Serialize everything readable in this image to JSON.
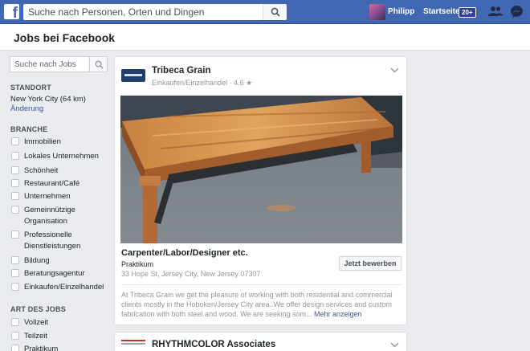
{
  "topbar": {
    "logo_letter": "f",
    "search_placeholder": "Suche nach Personen, Orten und Dingen",
    "user_name": "Philipp",
    "home_label": "Startseite",
    "home_badge": "20+"
  },
  "page": {
    "title": "Jobs bei Facebook"
  },
  "sidebar": {
    "search_placeholder": "Suche nach Jobs",
    "location_heading": "STANDORT",
    "location_value": "New York City (64 km)",
    "location_change": "Änderung",
    "industry_heading": "BRANCHE",
    "industries": [
      "Immobilien",
      "Lokales Unternehmen",
      "Schönheit",
      "Restaurant/Café",
      "Unternehmen",
      "Gemeinnützige Organisation",
      "Professionelle Dienstleistungen",
      "Bildung",
      "Beratungsagentur",
      "Einkaufen/Einzelhandel"
    ],
    "jobtype_heading": "ART DES JOBS",
    "job_types": [
      "Vollzeit",
      "Teilzeit",
      "Praktikum"
    ]
  },
  "jobs": [
    {
      "company": "Tribeca Grain",
      "category": "Einkaufen/Einzelhandel",
      "rating": "4.6 ★",
      "title": "Carpenter/Labor/Designer etc.",
      "type": "Praktikum",
      "address": "33 Hope St, Jersey City, New Jersey 07307",
      "apply_label": "Jetzt bewerben",
      "description": "At Tribeca Grain we get the pleasure of working with both residential and commercial clients mostly in the Hoboken/Jersey City area..We offer design services and custom fabrication with both steel and wood. We are seeking som...",
      "more_label": "Mehr anzeigen"
    },
    {
      "company": "RHYTHMCOLOR Associates"
    }
  ],
  "colors": {
    "brand": "#4267b2",
    "link": "#365899",
    "background": "#e9ebee"
  }
}
